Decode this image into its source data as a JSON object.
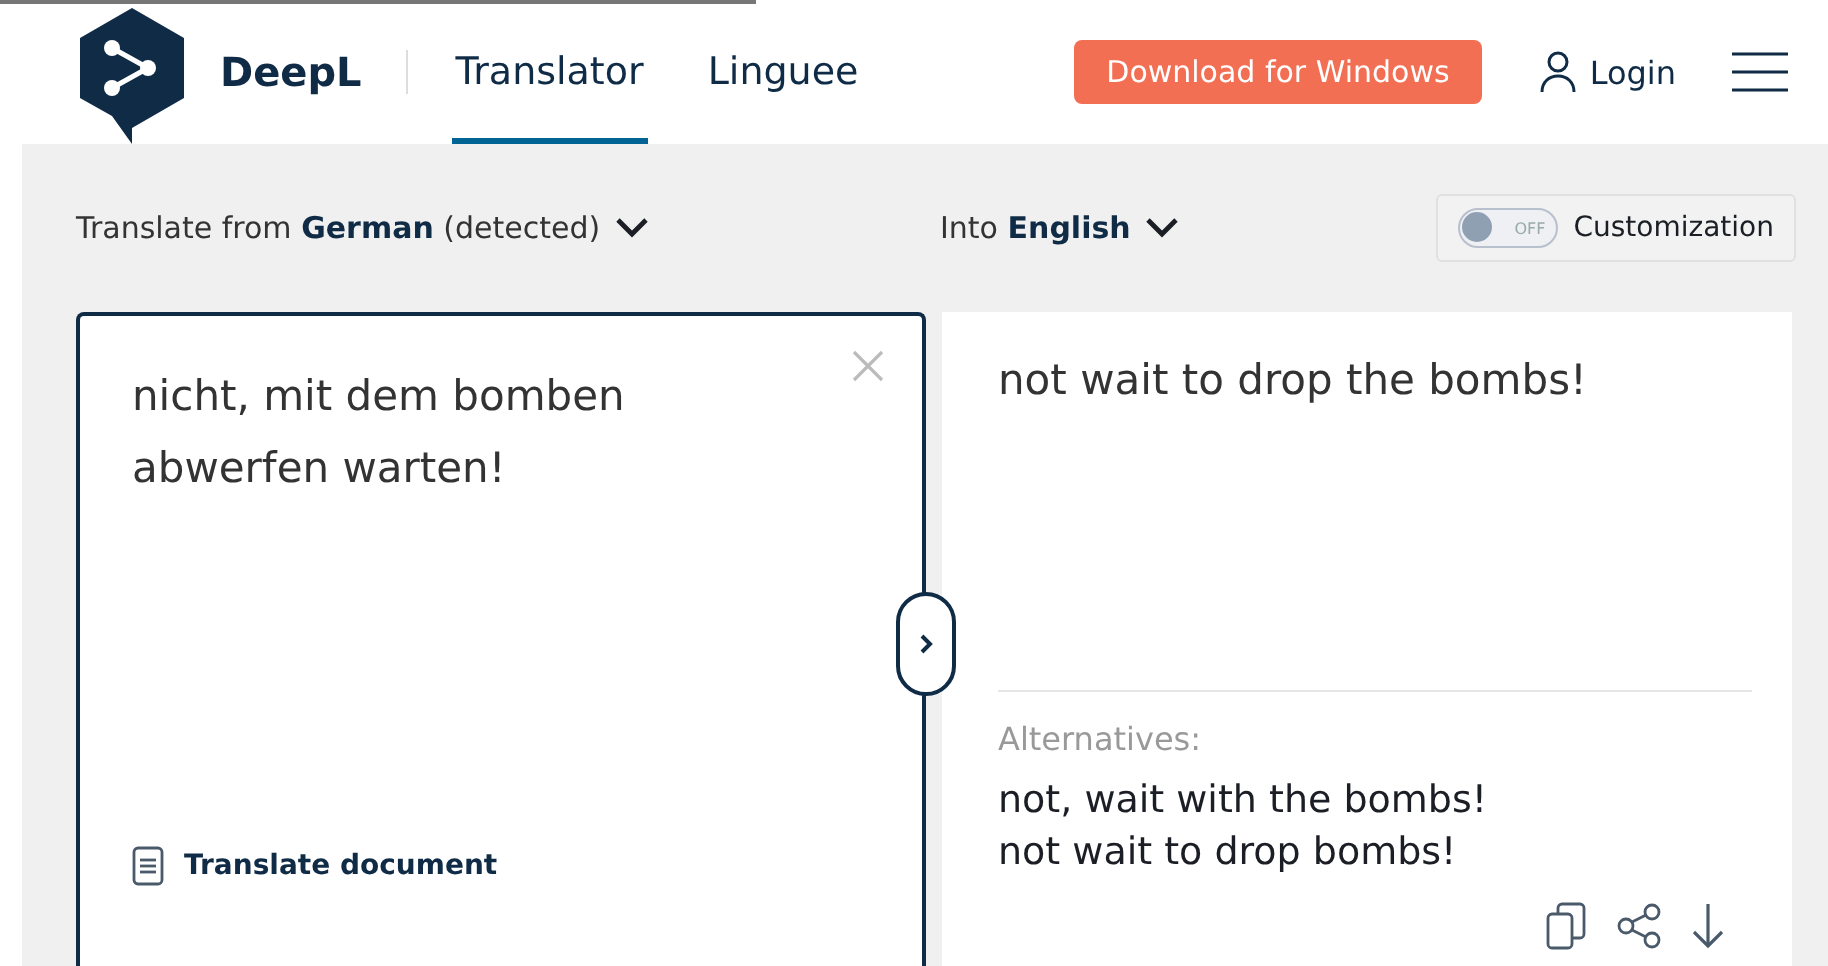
{
  "header": {
    "brand": "DeepL",
    "tabs": [
      {
        "label": "Translator",
        "selected": true
      },
      {
        "label": "Linguee",
        "selected": false
      }
    ],
    "download_button": "Download for Windows",
    "login": "Login"
  },
  "source": {
    "language_label": "Translate from **German** (detected)",
    "text": "nicht, mit dem bomben abwerfen warten!",
    "translate_document": "Translate document"
  },
  "target": {
    "language_label": "Into **English**",
    "customization": {
      "label": "Customization",
      "on": false,
      "toggle_text": "OFF"
    },
    "text": "not wait to drop the bombs!",
    "alternatives_label": "Alternatives:",
    "alternatives": [
      "not, wait with the bombs!",
      "not wait to drop bombs!"
    ]
  }
}
